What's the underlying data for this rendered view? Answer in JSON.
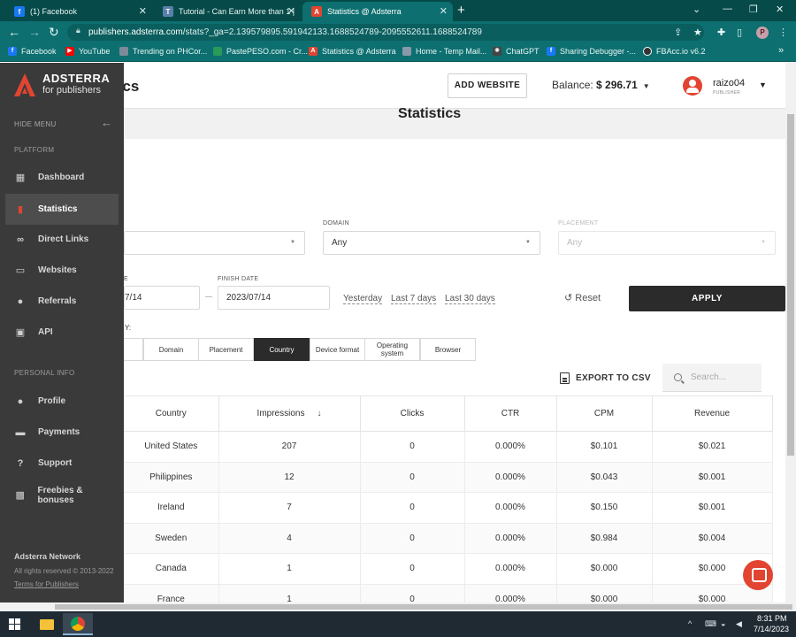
{
  "browser": {
    "tabs": [
      {
        "title": "(1) Facebook",
        "color": "#1877f2",
        "glyph": "f"
      },
      {
        "title": "Tutorial - Can Earn More than 1 |",
        "color": "#5a7fa8",
        "glyph": "T"
      },
      {
        "title": "Statistics @ Adsterra",
        "color": "#e24432",
        "glyph": "A"
      }
    ],
    "url_host": "publishers.adsterra.com",
    "url_rest": "/stats?_ga=2.139579895.591942133.1688524789-2095552611.1688524789",
    "profile_initial": "P",
    "bookmarks": [
      {
        "label": "Facebook",
        "color": "#1877f2"
      },
      {
        "label": "YouTube",
        "color": "#ff0000"
      },
      {
        "label": "Trending on PHCor...",
        "color": "#7d8a99"
      },
      {
        "label": "PastePESO.com - Cr...",
        "color": "#2a9a5a"
      },
      {
        "label": "Statistics @ Adsterra",
        "color": "#e24432"
      },
      {
        "label": "Home - Temp Mail...",
        "color": "#8899aa"
      },
      {
        "label": "ChatGPT",
        "color": "#444444"
      },
      {
        "label": "Sharing Debugger -...",
        "color": "#1877f2"
      },
      {
        "label": "FBAcc.io v6.2",
        "color": "#333333"
      }
    ],
    "more_bookmarks": "»"
  },
  "sidebar": {
    "brand_line1": "ADSTERRA",
    "brand_line2": "for publishers",
    "hide_menu": "HIDE MENU",
    "section_platform": "PLATFORM",
    "platform_items": [
      {
        "label": "Dashboard",
        "icon": "dashboard-icon",
        "glyph": "▦"
      },
      {
        "label": "Statistics",
        "icon": "bar-chart-icon",
        "glyph": "▮"
      },
      {
        "label": "Direct Links",
        "icon": "link-icon",
        "glyph": "∞"
      },
      {
        "label": "Websites",
        "icon": "monitor-icon",
        "glyph": "▭"
      },
      {
        "label": "Referrals",
        "icon": "people-icon",
        "glyph": "●"
      },
      {
        "label": "API",
        "icon": "terminal-icon",
        "glyph": "▣"
      }
    ],
    "section_personal": "PERSONAL INFO",
    "personal_items": [
      {
        "label": "Profile",
        "icon": "profile-icon",
        "glyph": "●"
      },
      {
        "label": "Payments",
        "icon": "card-icon",
        "glyph": "▬"
      },
      {
        "label": "Support",
        "icon": "help-icon",
        "glyph": "?"
      },
      {
        "label": "Freebies & bonuses",
        "icon": "gift-icon",
        "glyph": "▩"
      }
    ],
    "footer_title": "Adsterra Network",
    "footer_rights": "All rights reserved © 2013-2022",
    "footer_terms": "Terms for Publishers"
  },
  "header": {
    "page_title_visible": "tics",
    "add_website": "ADD WEBSITE",
    "balance_label": "Balance:",
    "balance_value": "$ 296.71",
    "username": "raizo04",
    "role": "PUBLISHER"
  },
  "stats": {
    "title": "Statistics",
    "domain_label": "DOMAIN",
    "domain_value": "Any",
    "placement_label": "PLACEMENT",
    "placement_value": "Any",
    "start_label_visible": "E",
    "start_value_visible": "7/14",
    "finish_label": "FINISH DATE",
    "finish_value": "2023/07/14",
    "quick_ranges": [
      "Yesterday",
      "Last 7 days",
      "Last 30 days"
    ],
    "reset": "Reset",
    "apply": "APPLY",
    "group_by_visible": "Y:",
    "group_tabs": [
      "Domain",
      "Placement",
      "Country",
      "Device format",
      "Operating system",
      "Browser"
    ],
    "active_group": "Country",
    "export": "EXPORT TO CSV",
    "search_placeholder": "Search...",
    "columns": [
      "Country",
      "Impressions",
      "Clicks",
      "CTR",
      "CPM",
      "Revenue"
    ],
    "sort_indicator": "↓",
    "rows": [
      [
        "United States",
        "207",
        "0",
        "0.000%",
        "$0.101",
        "$0.021"
      ],
      [
        "Philippines",
        "12",
        "0",
        "0.000%",
        "$0.043",
        "$0.001"
      ],
      [
        "Ireland",
        "7",
        "0",
        "0.000%",
        "$0.150",
        "$0.001"
      ],
      [
        "Sweden",
        "4",
        "0",
        "0.000%",
        "$0.984",
        "$0.004"
      ],
      [
        "Canada",
        "1",
        "0",
        "0.000%",
        "$0.000",
        "$0.000"
      ],
      [
        "France",
        "1",
        "0",
        "0.000%",
        "$0.000",
        "$0.000"
      ]
    ]
  },
  "taskbar": {
    "time": "8:31 PM",
    "date": "7/14/2023"
  }
}
